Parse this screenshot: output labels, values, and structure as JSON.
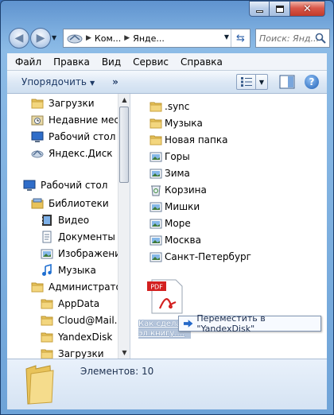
{
  "window": {
    "controls": {
      "minimize": "minimize",
      "maximize": "maximize",
      "close": "close"
    }
  },
  "address": {
    "segments": [
      "Ком...",
      "Янде..."
    ],
    "search_placeholder": "Поиск: Янд..."
  },
  "menu": [
    "Файл",
    "Правка",
    "Вид",
    "Сервис",
    "Справка"
  ],
  "toolbar": {
    "organize": "Упорядочить",
    "more": "»"
  },
  "nav": {
    "items": [
      {
        "label": "Загрузки",
        "icon": "downloads-folder-icon"
      },
      {
        "label": "Недавние места",
        "icon": "recent-places-icon"
      },
      {
        "label": "Рабочий стол",
        "icon": "desktop-icon"
      },
      {
        "label": "Яндекс.Диск",
        "icon": "yandex-disk-icon"
      },
      {
        "label": "Рабочий стол",
        "icon": "desktop-icon"
      },
      {
        "label": "Библиотеки",
        "icon": "libraries-icon"
      },
      {
        "label": "Видео",
        "icon": "video-library-icon"
      },
      {
        "label": "Документы",
        "icon": "documents-library-icon"
      },
      {
        "label": "Изображения",
        "icon": "pictures-library-icon"
      },
      {
        "label": "Музыка",
        "icon": "music-library-icon"
      },
      {
        "label": "Администратор",
        "icon": "user-folder-icon"
      },
      {
        "label": "AppData",
        "icon": "folder-icon"
      },
      {
        "label": "Cloud@Mail.Ru",
        "icon": "folder-icon"
      },
      {
        "label": "YandexDisk",
        "icon": "folder-icon"
      },
      {
        "label": "Загрузки",
        "icon": "folder-icon"
      }
    ]
  },
  "files": [
    {
      "label": ".sync",
      "icon": "folder-icon"
    },
    {
      "label": "Музыка",
      "icon": "folder-icon"
    },
    {
      "label": "Новая папка",
      "icon": "folder-icon"
    },
    {
      "label": "Горы",
      "icon": "image-folder-icon"
    },
    {
      "label": "Зима",
      "icon": "image-folder-icon"
    },
    {
      "label": "Корзина",
      "icon": "recycle-bin-icon"
    },
    {
      "label": "Мишки",
      "icon": "image-folder-icon"
    },
    {
      "label": "Море",
      "icon": "image-folder-icon"
    },
    {
      "label": "Москва",
      "icon": "image-folder-icon"
    },
    {
      "label": "Санкт-Петербург",
      "icon": "image-folder-icon"
    }
  ],
  "drag": {
    "file_label_line1": "Как сделать",
    "file_label_line2": "эл книгу....",
    "tooltip": "Переместить в \"YandexDisk\""
  },
  "details": {
    "count": "Элементов: 10"
  },
  "colors": {
    "folder": "#e8c35a",
    "accent": "#2b5fa8",
    "pdf_red": "#d3201f"
  }
}
